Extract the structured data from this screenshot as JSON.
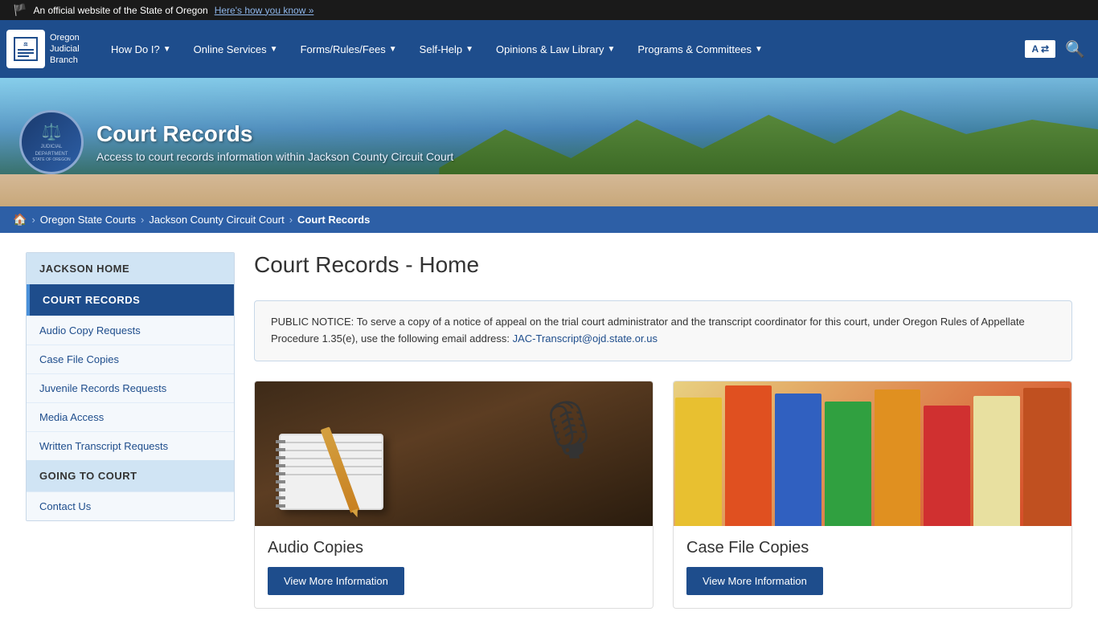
{
  "topbar": {
    "text": "An official website of the State of Oregon",
    "link": "Here's how you know »"
  },
  "nav": {
    "logo": {
      "line1": "Oregon",
      "line2": "Judicial",
      "line3": "Branch"
    },
    "items": [
      {
        "label": "How Do I?",
        "hasDropdown": true
      },
      {
        "label": "Online Services",
        "hasDropdown": true
      },
      {
        "label": "Forms/Rules/Fees",
        "hasDropdown": true
      },
      {
        "label": "Self-Help",
        "hasDropdown": true
      },
      {
        "label": "Opinions & Law Library",
        "hasDropdown": true
      },
      {
        "label": "Programs & Committees",
        "hasDropdown": true
      }
    ],
    "langBtn": "A ⇄",
    "searchIcon": "🔍"
  },
  "hero": {
    "title": "Court Records",
    "subtitle": "Access to court records information within Jackson County Circuit Court",
    "seal": {
      "line1": "JUDICIAL",
      "line2": "DEPARTMENT",
      "line3": "STATE OF OREGON"
    }
  },
  "breadcrumb": {
    "home": "🏠",
    "items": [
      {
        "label": "Oregon State Courts",
        "link": true
      },
      {
        "label": "Jackson County Circuit Court",
        "link": true
      },
      {
        "label": "Court Records",
        "link": false
      }
    ]
  },
  "pageTitle": "Court Records - Home",
  "sidebar": {
    "jacksonHome": "JACKSON HOME",
    "courtRecords": "COURT RECORDS",
    "items": [
      {
        "label": "Audio Copy Requests"
      },
      {
        "label": "Case File Copies"
      },
      {
        "label": "Juvenile Records Requests"
      },
      {
        "label": "Media Access"
      },
      {
        "label": "Written Transcript Requests"
      }
    ],
    "goingToCourt": "GOING TO COURT",
    "contactItems": [
      {
        "label": "Contact Us"
      }
    ]
  },
  "notice": {
    "text": "PUBLIC NOTICE: To serve a copy of a notice of appeal on the trial court administrator and the transcript coordinator for this court, under Oregon Rules of Appellate Procedure 1.35(e), use the following email address:",
    "email": "JAC-Transcript@ojd.state.or.us"
  },
  "cards": [
    {
      "title": "Audio Copies",
      "btnLabel": "View More Information",
      "type": "audio"
    },
    {
      "title": "Case File Copies",
      "btnLabel": "View More Information",
      "type": "files"
    }
  ]
}
